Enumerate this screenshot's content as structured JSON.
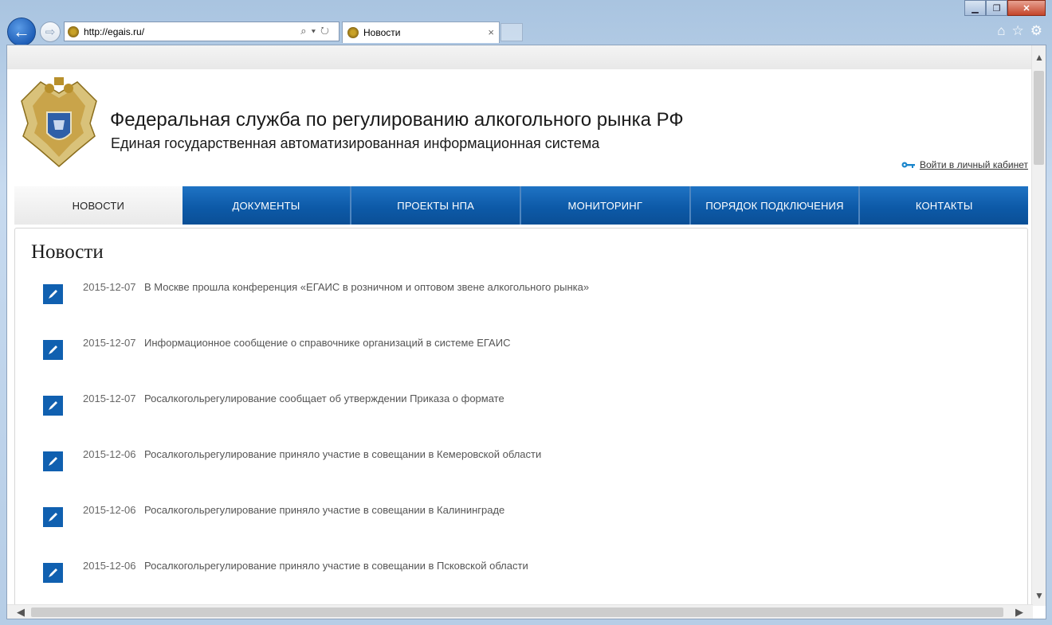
{
  "browser": {
    "url": "http://egais.ru/",
    "tab_title": "Новости",
    "tab_close": "×",
    "back_glyph": "←",
    "forward_glyph": "⇨",
    "addr_tools": "⌕▾↻",
    "window_controls": {
      "minimize": "▁",
      "maximize": "❐",
      "close": "✕"
    },
    "right_icons": {
      "home": "⌂",
      "favorites": "☆",
      "settings": "⚙"
    }
  },
  "site": {
    "title": "Федеральная служба по регулированию алкогольного рынка РФ",
    "subtitle": "Единая государственная автоматизированная информационная система",
    "login_label": "Войти в личный кабинет"
  },
  "nav": {
    "items": [
      {
        "label": "НОВОСТИ",
        "active": true
      },
      {
        "label": "ДОКУМЕНТЫ",
        "active": false
      },
      {
        "label": "ПРОЕКТЫ НПА",
        "active": false
      },
      {
        "label": "МОНИТОРИНГ",
        "active": false
      },
      {
        "label": "ПОРЯДОК ПОДКЛЮЧЕНИЯ",
        "active": false
      },
      {
        "label": "КОНТАКТЫ",
        "active": false
      }
    ]
  },
  "news": {
    "heading": "Новости",
    "items": [
      {
        "date": "2015-12-07",
        "text": "В Москве прошла конференция «ЕГАИС в розничном и оптовом звене алкогольного рынка»"
      },
      {
        "date": "2015-12-07",
        "text": "Информационное сообщение о справочнике организаций в системе ЕГАИС"
      },
      {
        "date": "2015-12-07",
        "text": "Росалкогольрегулирование сообщает об утверждении Приказа о формате"
      },
      {
        "date": "2015-12-06",
        "text": "Росалкогольрегулирование приняло участие в совещании в Кемеровской области"
      },
      {
        "date": "2015-12-06",
        "text": "Росалкогольрегулирование приняло участие в совещании в Калининграде"
      },
      {
        "date": "2015-12-06",
        "text": "Росалкогольрегулирование приняло участие в совещании в Псковской области"
      }
    ]
  },
  "colors": {
    "nav_blue": "#0d5aa8",
    "icon_blue": "#1060b0",
    "close_red": "#c4452a"
  },
  "icons": {
    "emblem": "eagle-emblem-icon",
    "key": "key-icon",
    "news": "pen-icon"
  }
}
